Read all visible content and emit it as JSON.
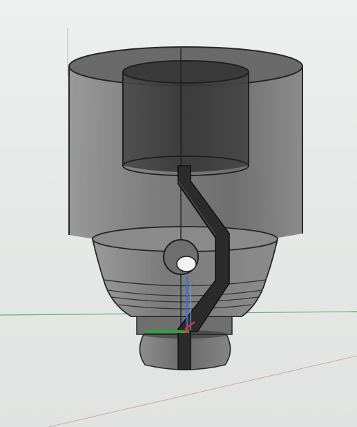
{
  "viewport": {
    "background": "#e7e9e8"
  },
  "model": {
    "body_color": "#5f5f5f",
    "edge_color": "#262626",
    "inner_color": "#3d3d3d",
    "channel_color": "#2b2b2b"
  },
  "axes": {
    "x_axis_color": "#2fa33a",
    "y_axis_color": "#3a6fd8",
    "z_axis_color": "#d23a2c",
    "ground_line_color": "#55b85a",
    "diagonal_line_color": "#c9a9a0"
  }
}
